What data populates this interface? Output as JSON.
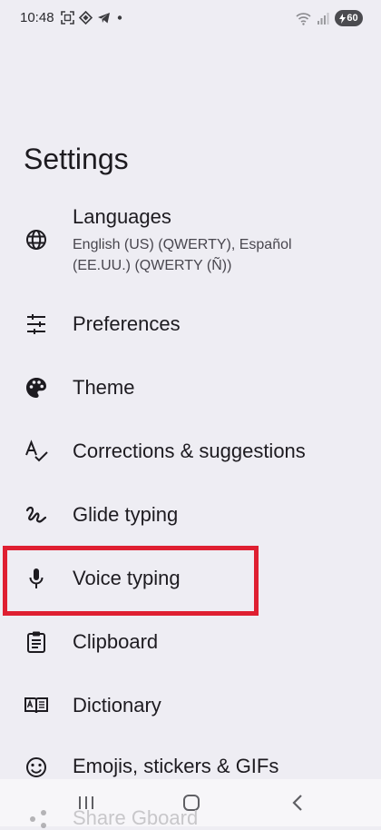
{
  "status_bar": {
    "time": "10:48",
    "battery": "60",
    "icons": [
      "screenshot-icon",
      "diamond-app-icon",
      "telegram-icon",
      "dot-icon",
      "wifi-icon",
      "signal-icon",
      "battery-icon"
    ]
  },
  "page": {
    "title": "Settings"
  },
  "settings": {
    "items": [
      {
        "label": "Languages",
        "subtitle": "English (US) (QWERTY), Español (EE.UU.) (QWERTY (Ñ))",
        "icon": "globe-icon"
      },
      {
        "label": "Preferences",
        "icon": "sliders-icon"
      },
      {
        "label": "Theme",
        "icon": "palette-icon"
      },
      {
        "label": "Corrections & suggestions",
        "icon": "spellcheck-icon"
      },
      {
        "label": "Glide typing",
        "icon": "gesture-icon"
      },
      {
        "label": "Voice typing",
        "icon": "mic-icon"
      },
      {
        "label": "Clipboard",
        "icon": "clipboard-icon"
      },
      {
        "label": "Dictionary",
        "icon": "dictionary-icon"
      },
      {
        "label": "Emojis, stickers & GIFs",
        "icon": "emoji-icon"
      },
      {
        "label": "Share Gboard",
        "icon": "share-icon"
      }
    ]
  },
  "colors": {
    "background": "#eeedf3",
    "text": "#1d1b20",
    "highlight": "#df1f31",
    "nav_bar": "#f7f6f9"
  },
  "nav_bar": {
    "buttons": [
      "recent-apps-icon",
      "home-icon",
      "back-icon"
    ]
  }
}
